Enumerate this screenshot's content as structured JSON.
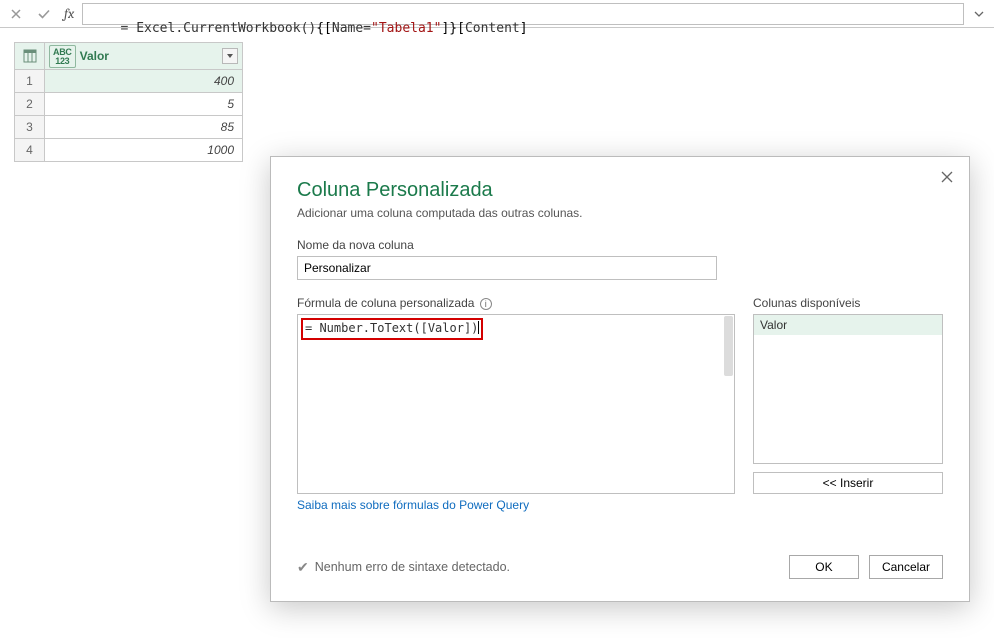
{
  "formula_bar": {
    "fx_label": "fx",
    "formula_raw": "= Excel.CurrentWorkbook(){[Name=\"Tabela1\"]}[Content]",
    "p_eq": "= ",
    "p_fn": "Excel.CurrentWorkbook()",
    "p_br1": "{[",
    "p_key": "Name=",
    "p_str": "\"Tabela1\"",
    "p_br2": "]}[",
    "p_content": "Content",
    "p_br3": "]"
  },
  "table": {
    "type_badge": "ABC\n123",
    "column_name": "Valor",
    "rows": [
      {
        "n": "1",
        "v": "400"
      },
      {
        "n": "2",
        "v": "5"
      },
      {
        "n": "3",
        "v": "85"
      },
      {
        "n": "4",
        "v": "1000"
      }
    ]
  },
  "dialog": {
    "title": "Coluna Personalizada",
    "subtitle": "Adicionar uma coluna computada das outras colunas.",
    "name_label": "Nome da nova coluna",
    "name_value": "Personalizar",
    "formula_label": "Fórmula de coluna personalizada",
    "formula_value": "= Number.ToText([Valor])",
    "available_label": "Colunas disponíveis",
    "available_columns": [
      "Valor"
    ],
    "insert_label": "<< Inserir",
    "learn_more": "Saiba mais sobre fórmulas do Power Query",
    "status_text": "Nenhum erro de sintaxe detectado.",
    "ok_label": "OK",
    "cancel_label": "Cancelar"
  }
}
